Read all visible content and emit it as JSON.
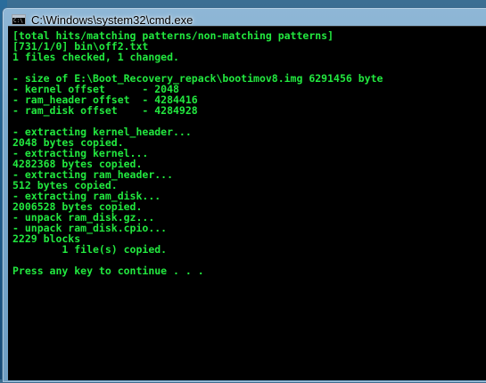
{
  "window": {
    "title": "C:\\Windows\\system32\\cmd.exe",
    "icon": "cmd-icon"
  },
  "console": {
    "text_color": "#22e83f",
    "background_color": "#000000",
    "lines": [
      "[total hits/matching patterns/non-matching patterns]",
      "[731/1/0] bin\\off2.txt",
      "1 files checked, 1 changed.",
      "",
      "- size of E:\\Boot_Recovery_repack\\bootimov8.img 6291456 byte",
      "- kernel offset      - 2048",
      "- ram_header offset  - 4284416",
      "- ram_disk offset    - 4284928",
      "",
      "- extracting kernel_header...",
      "2048 bytes copied.",
      "- extracting kernel...",
      "4282368 bytes copied.",
      "- extracting ram_header...",
      "512 bytes copied.",
      "- extracting ram_disk...",
      "2006528 bytes copied.",
      "- unpack ram_disk.gz...",
      "- unpack ram_disk.cpio...",
      "2229 blocks",
      "        1 file(s) copied.",
      "",
      "Press any key to continue . . ."
    ]
  }
}
